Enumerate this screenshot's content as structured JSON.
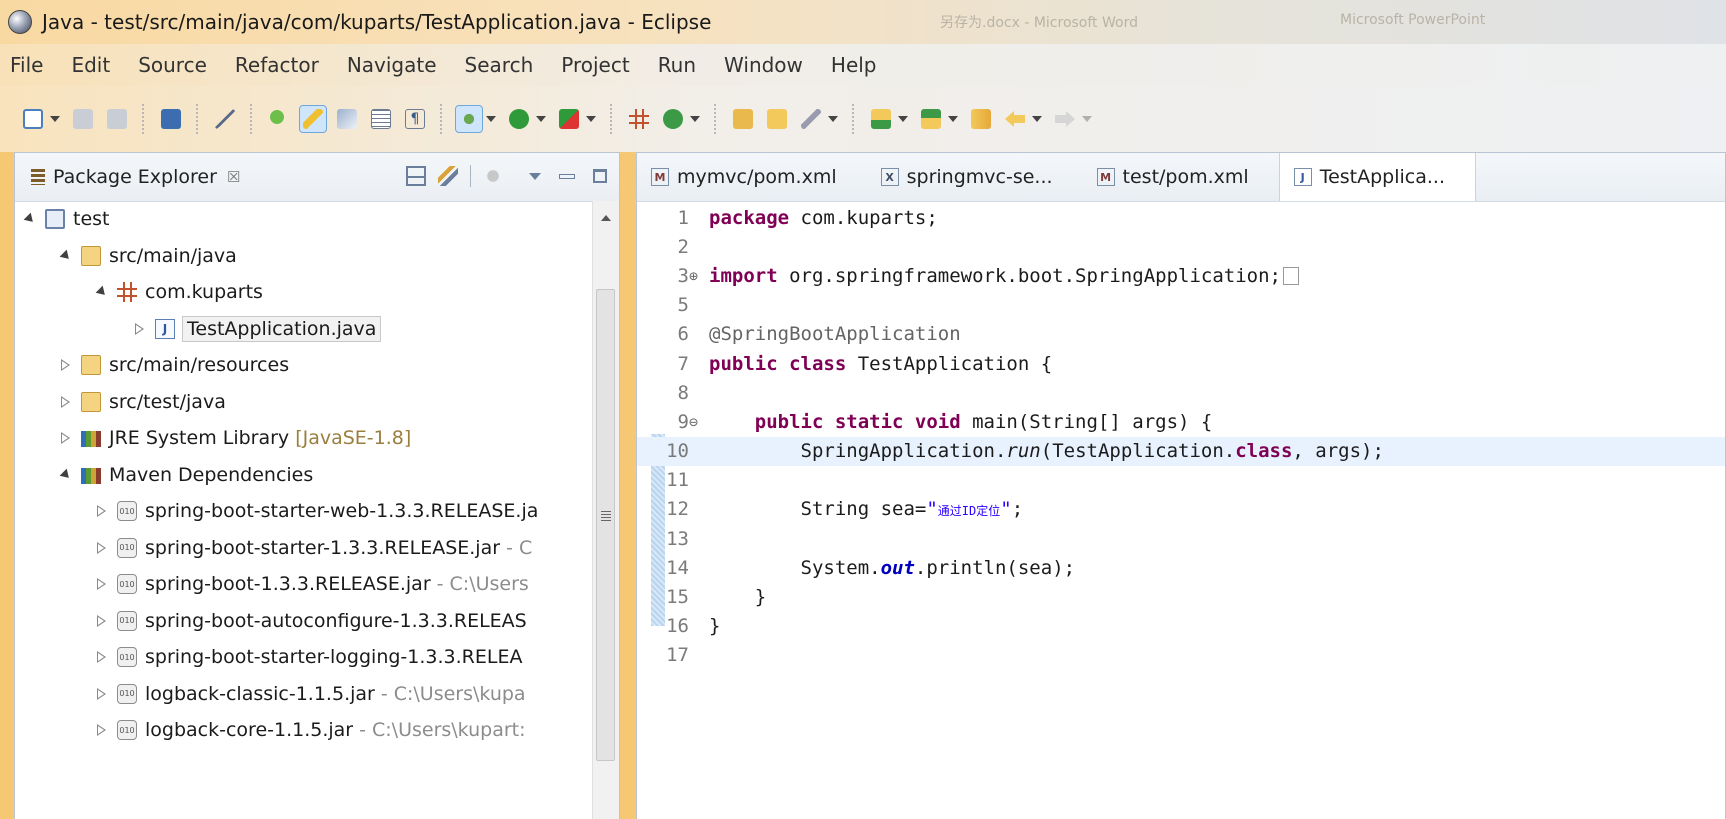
{
  "window": {
    "title": "Java - test/src/main/java/com/kuparts/TestApplication.java - Eclipse",
    "background_ghost": [
      "另存为.docx - Microsoft Word",
      "Microsoft PowerPoint"
    ]
  },
  "menu": [
    "File",
    "Edit",
    "Source",
    "Refactor",
    "Navigate",
    "Search",
    "Project",
    "Run",
    "Window",
    "Help"
  ],
  "toolbar": {
    "icons": [
      "new-icon",
      "save-icon",
      "save-all-icon",
      "open-console-icon",
      "skip-breakpoints-icon",
      "open-type-icon",
      "mark-occurrences-icon",
      "toggle-whitespace-icon",
      "show-whitespace-icon",
      "debug-icon",
      "run-icon",
      "external-tools-icon",
      "new-java-package-icon",
      "new-java-class-icon",
      "open-folder-icon",
      "open-task-icon",
      "pen-icon",
      "next-annotation-icon",
      "previous-annotation-icon",
      "back-icon",
      "forward-icon"
    ],
    "accent": "#4a7fc0"
  },
  "explorer": {
    "title": "Package Explorer",
    "close_glyph": "☒",
    "tree": [
      {
        "label": "test",
        "sub": "",
        "icon": "project",
        "indent": 0,
        "state": "open"
      },
      {
        "label": "src/main/java",
        "sub": "",
        "icon": "srcfolder",
        "indent": 1,
        "state": "open"
      },
      {
        "label": "com.kuparts",
        "sub": "",
        "icon": "package",
        "indent": 2,
        "state": "open"
      },
      {
        "label": "TestApplication.java",
        "sub": "",
        "icon": "java",
        "indent": 3,
        "state": "closed",
        "selected": true
      },
      {
        "label": "src/main/resources",
        "sub": "",
        "icon": "srcfolder",
        "indent": 1,
        "state": "closed"
      },
      {
        "label": "src/test/java",
        "sub": "",
        "icon": "srcfolder",
        "indent": 1,
        "state": "closed"
      },
      {
        "label": "JRE System Library",
        "sub": "[JavaSE-1.8]",
        "icon": "lib",
        "indent": 1,
        "state": "closed"
      },
      {
        "label": "Maven Dependencies",
        "sub": "",
        "icon": "lib",
        "indent": 1,
        "state": "open"
      },
      {
        "label": "spring-boot-starter-web-1.3.3.RELEASE.ja",
        "sub": "",
        "icon": "jar",
        "indent": 2,
        "state": "closed"
      },
      {
        "label": "spring-boot-starter-1.3.3.RELEASE.jar",
        "sub": "- C",
        "icon": "jar",
        "indent": 2,
        "state": "closed"
      },
      {
        "label": "spring-boot-1.3.3.RELEASE.jar",
        "sub": "- C:\\Users",
        "icon": "jar",
        "indent": 2,
        "state": "closed"
      },
      {
        "label": "spring-boot-autoconfigure-1.3.3.RELEAS",
        "sub": "",
        "icon": "jar",
        "indent": 2,
        "state": "closed"
      },
      {
        "label": "spring-boot-starter-logging-1.3.3.RELEA",
        "sub": "",
        "icon": "jar",
        "indent": 2,
        "state": "closed"
      },
      {
        "label": "logback-classic-1.1.5.jar",
        "sub": "- C:\\Users\\kupa",
        "icon": "jar",
        "indent": 2,
        "state": "closed"
      },
      {
        "label": "logback-core-1.1.5.jar",
        "sub": "- C:\\Users\\kupart:",
        "icon": "jar",
        "indent": 2,
        "state": "closed"
      }
    ]
  },
  "editor": {
    "tabs": [
      {
        "label": "mymvc/pom.xml",
        "icon": "M",
        "active": false
      },
      {
        "label": "springmvc-se...",
        "icon": "X",
        "active": false
      },
      {
        "label": "test/pom.xml",
        "icon": "M",
        "active": false
      },
      {
        "label": "TestApplica...",
        "icon": "J",
        "active": true
      }
    ],
    "lines": [
      {
        "n": "1",
        "mark": "",
        "tokens": [
          [
            "kw",
            "package"
          ],
          [
            "",
            "com.kuparts;"
          ]
        ]
      },
      {
        "n": "2",
        "mark": "",
        "tokens": []
      },
      {
        "n": "3",
        "mark": "⊕",
        "tokens": [
          [
            "kw",
            "import"
          ],
          [
            "",
            " org.springframework.boot.SpringApplication;"
          ],
          [
            "fold",
            ""
          ]
        ]
      },
      {
        "n": "5",
        "mark": "",
        "tokens": []
      },
      {
        "n": "6",
        "mark": "",
        "tokens": [
          [
            "an",
            "@SpringBootApplication"
          ]
        ]
      },
      {
        "n": "7",
        "mark": "",
        "tokens": [
          [
            "kw",
            "public class"
          ],
          [
            "",
            " TestApplication {"
          ]
        ]
      },
      {
        "n": "8",
        "mark": "",
        "tokens": []
      },
      {
        "n": "9",
        "mark": "⊖",
        "tokens": [
          [
            "",
            "    "
          ],
          [
            "kw",
            "public static void"
          ],
          [
            "",
            " main(String[] args) {"
          ]
        ]
      },
      {
        "n": "10",
        "mark": "",
        "current": true,
        "tokens": [
          [
            "",
            "        SpringApplication."
          ],
          [
            "it",
            "run"
          ],
          [
            "",
            "(TestApplication."
          ],
          [
            "kw",
            "class"
          ],
          [
            "",
            ", args);"
          ]
        ]
      },
      {
        "n": "11",
        "mark": "",
        "tokens": []
      },
      {
        "n": "12",
        "mark": "",
        "tokens": [
          [
            "",
            "        String sea="
          ],
          [
            "str",
            "\""
          ],
          [
            "str-cn",
            "通过ID定位"
          ],
          [
            "str",
            "\""
          ],
          [
            "",
            ";"
          ]
        ]
      },
      {
        "n": "13",
        "mark": "",
        "tokens": []
      },
      {
        "n": "14",
        "mark": "",
        "tokens": [
          [
            "",
            "        System."
          ],
          [
            "fld",
            "out"
          ],
          [
            "",
            ".println(sea);"
          ]
        ]
      },
      {
        "n": "15",
        "mark": "",
        "tokens": [
          [
            "",
            "    }"
          ]
        ]
      },
      {
        "n": "16",
        "mark": "",
        "tokens": [
          [
            "",
            "}"
          ]
        ]
      },
      {
        "n": "17",
        "mark": "",
        "tokens": []
      }
    ]
  }
}
